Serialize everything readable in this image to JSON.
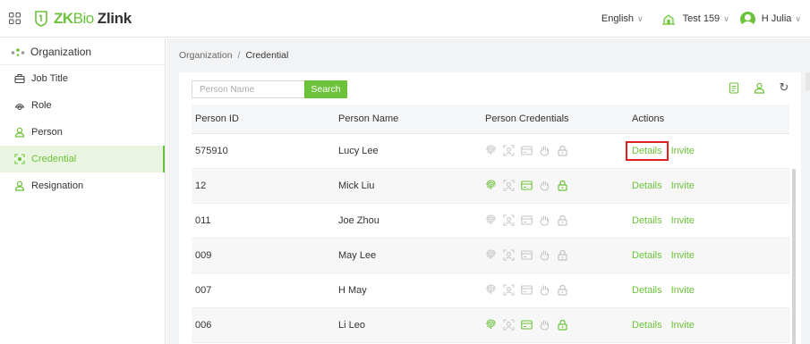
{
  "header": {
    "logo_zk": "ZK",
    "logo_bio": "Bio",
    "logo_zlink": "Zlink",
    "language": "English",
    "tenant": "Test 159",
    "user": "H Julia",
    "brand_color": "#6cc23a"
  },
  "sidebar": {
    "title": "Organization",
    "items": [
      {
        "label": "Job Title",
        "icon": "job-title-icon",
        "active": false
      },
      {
        "label": "Role",
        "icon": "role-icon",
        "active": false
      },
      {
        "label": "Person",
        "icon": "person-icon",
        "active": false
      },
      {
        "label": "Credential",
        "icon": "credential-icon",
        "active": true
      },
      {
        "label": "Resignation",
        "icon": "resignation-icon",
        "active": false
      }
    ]
  },
  "breadcrumb": {
    "root": "Organization",
    "separator": "/",
    "current": "Credential"
  },
  "search": {
    "placeholder": "Person Name",
    "button": "Search"
  },
  "table": {
    "columns": [
      "Person ID",
      "Person Name",
      "Person Credentials",
      "Actions"
    ],
    "credential_types": [
      "fingerprint",
      "face",
      "card",
      "palm",
      "password"
    ],
    "rows": [
      {
        "id": "575910",
        "name": "Lucy Lee",
        "creds": [
          false,
          false,
          false,
          false,
          false
        ],
        "highlight_details": true
      },
      {
        "id": "12",
        "name": "Mick Liu",
        "creds": [
          true,
          false,
          true,
          false,
          true
        ],
        "highlight_details": false
      },
      {
        "id": "011",
        "name": "Joe Zhou",
        "creds": [
          false,
          false,
          false,
          false,
          false
        ],
        "highlight_details": false
      },
      {
        "id": "009",
        "name": "May Lee",
        "creds": [
          false,
          false,
          false,
          false,
          false
        ],
        "highlight_details": false
      },
      {
        "id": "007",
        "name": "H May",
        "creds": [
          false,
          false,
          false,
          false,
          false
        ],
        "highlight_details": false
      },
      {
        "id": "006",
        "name": "Li Leo",
        "creds": [
          true,
          false,
          true,
          false,
          true
        ],
        "highlight_details": false
      }
    ],
    "actions": {
      "details": "Details",
      "invite": "Invite"
    }
  },
  "colors": {
    "active_green": "#6cc23a",
    "inactive_gray": "#c4c4c4",
    "highlight_red": "#e02020"
  }
}
